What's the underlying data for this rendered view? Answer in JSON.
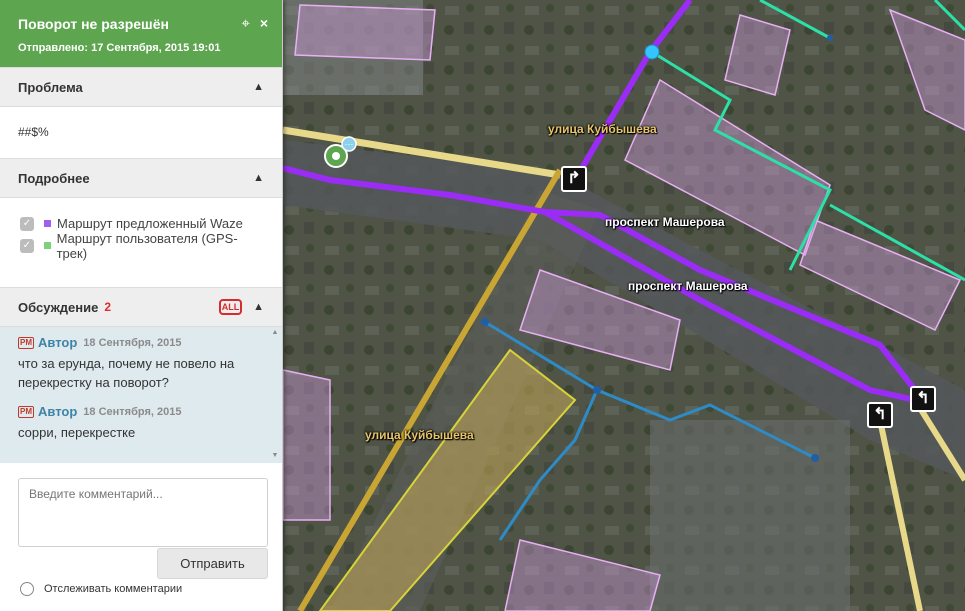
{
  "panel": {
    "title": "Поворот не разрешён",
    "sent": "Отправлено: 17 Сентября, 2015 19:01",
    "target_icon": "crosshair-icon",
    "close_icon": "close-icon",
    "close_glyph": "×",
    "target_glyph": "⌖"
  },
  "problem": {
    "header": "Проблема",
    "text": "##$%"
  },
  "details": {
    "header": "Подробнее",
    "items": [
      {
        "label": "Маршрут предложенный Waze",
        "color": "#a35cf0"
      },
      {
        "label": "Маршрут пользователя (GPS-трек)",
        "color": "#7dd17a"
      }
    ]
  },
  "discussion": {
    "header": "Обсуждение",
    "count": "2",
    "all_badge": "ALL",
    "comments": [
      {
        "pm": "PM",
        "author": "Автор",
        "date": "18 Сентября, 2015",
        "text": "что за ерунда, почему не повело на перекрестку на поворот?"
      },
      {
        "pm": "PM",
        "author": "Автор",
        "date": "18 Сентября, 2015",
        "text": "сорри, перекрестке"
      }
    ]
  },
  "composer": {
    "placeholder": "Введите комментарий...",
    "send_label": "Отправить",
    "follow_label": "Отслеживать комментарии"
  },
  "map": {
    "labels": [
      {
        "text": "улица Куйбышева",
        "color": "yellow"
      },
      {
        "text": "проспект Машерова",
        "color": "white"
      },
      {
        "text": "проспект Машерова",
        "color": "white"
      },
      {
        "text": "улица Куйбышева",
        "color": "yellow"
      }
    ],
    "colors": {
      "waze_route": "#9b2cf5",
      "user_track": "#2e8bc7",
      "road_yellow": "#e2d37a",
      "road_gold": "#c9a534",
      "building_fill": "rgba(214,160,230,0.45)",
      "building_stroke": "#e2a9ee",
      "teal": "#2de0a8"
    }
  }
}
